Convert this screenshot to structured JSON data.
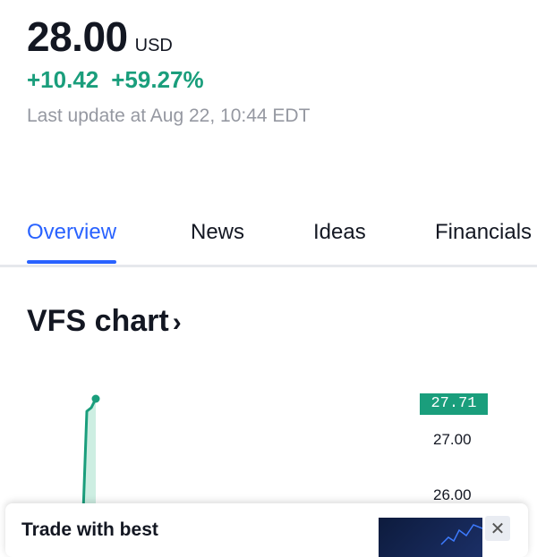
{
  "quote": {
    "price": "28.00",
    "currency": "USD",
    "change_abs": "+10.42",
    "change_pct": "+59.27%",
    "last_update": "Last update at Aug 22, 10:44 EDT"
  },
  "tabs": [
    {
      "label": "Overview",
      "active": true
    },
    {
      "label": "News",
      "active": false
    },
    {
      "label": "Ideas",
      "active": false
    },
    {
      "label": "Financials",
      "active": false
    }
  ],
  "chart": {
    "title": "VFS chart",
    "title_chevron": "›",
    "last_price_tag": "27.71",
    "y_ticks": [
      "27.00",
      "26.00"
    ],
    "line_color": "#1a9e7c"
  },
  "ad": {
    "text": "Trade with best",
    "close_icon": "close-icon"
  },
  "colors": {
    "positive": "#1a9e7c",
    "accent": "#2962ff",
    "muted": "#9598a1"
  }
}
